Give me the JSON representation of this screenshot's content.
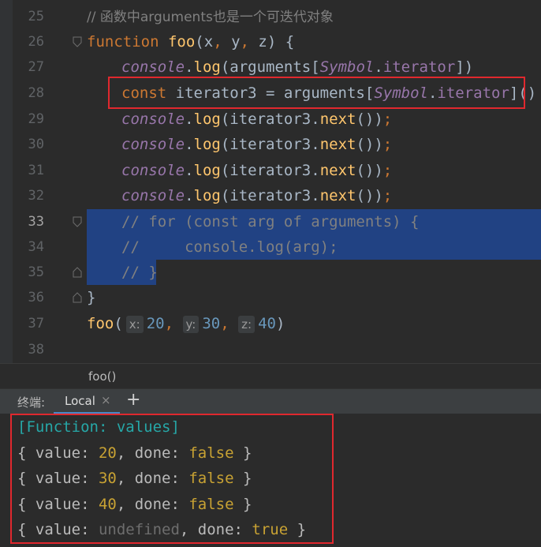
{
  "editor": {
    "line_numbers": [
      "25",
      "26",
      "27",
      "28",
      "29",
      "30",
      "31",
      "32",
      "33",
      "34",
      "35",
      "36",
      "37",
      "38"
    ],
    "active_line": "33",
    "lines": {
      "l25": {
        "comment": "// 函数中arguments也是一个可迭代对象"
      },
      "l26": {
        "kw": "function",
        "name": " foo",
        "open": "(",
        "p1": "x",
        "c1": ", ",
        "p2": "y",
        "c2": ", ",
        "p3": "z",
        "close": ") {"
      },
      "l27": {
        "obj": "console",
        "dot": ".",
        "method": "log",
        "a": "(arguments[",
        "sym": "Symbol",
        "b": ".",
        "prop": "iterator",
        "c": "])"
      },
      "l28": {
        "kw": "const",
        "a": " iterator3 = arguments[",
        "sym": "Symbol",
        "b": ".",
        "prop": "iterator",
        "c": "]()"
      },
      "l29": {
        "obj": "console",
        "dot": ".",
        "method": "log",
        "a": "(iterator3.",
        "m2": "next",
        "b": "())",
        "semi": ";"
      },
      "l30": {
        "obj": "console",
        "dot": ".",
        "method": "log",
        "a": "(iterator3.",
        "m2": "next",
        "b": "())",
        "semi": ";"
      },
      "l31": {
        "obj": "console",
        "dot": ".",
        "method": "log",
        "a": "(iterator3.",
        "m2": "next",
        "b": "())",
        "semi": ";"
      },
      "l32": {
        "obj": "console",
        "dot": ".",
        "method": "log",
        "a": "(iterator3.",
        "m2": "next",
        "b": "())",
        "semi": ";"
      },
      "l33": {
        "comment": "// for (const arg of arguments) {"
      },
      "l34": {
        "comment": "//     console.log(arg);"
      },
      "l35": {
        "comment": "// }"
      },
      "l36": {
        "text": "}"
      },
      "l37": {
        "fn": "foo",
        "open": "(",
        "h1": "x:",
        "v1": "20",
        "c1": ", ",
        "h2": "y:",
        "v2": "30",
        "c2": ", ",
        "h3": "z:",
        "v3": "40",
        "close": ")"
      }
    }
  },
  "breadcrumb": {
    "label": "foo()"
  },
  "terminal": {
    "label": "终端:",
    "tab_label": "Local",
    "close_glyph": "×",
    "add_glyph": "+",
    "output": {
      "o1": "[Function: values]",
      "o2": {
        "a": "{ value: ",
        "v": "20",
        "b": ", done: ",
        "d": "false",
        "c": " }"
      },
      "o3": {
        "a": "{ value: ",
        "v": "30",
        "b": ", done: ",
        "d": "false",
        "c": " }"
      },
      "o4": {
        "a": "{ value: ",
        "v": "40",
        "b": ", done: ",
        "d": "false",
        "c": " }"
      },
      "o5": {
        "a": "{ value: ",
        "v": "undefined",
        "b": ", done: ",
        "d": "true",
        "c": " }"
      }
    }
  },
  "colors": {
    "background": "#2b2b2b",
    "selection": "#214283",
    "highlight_box": "#e0282e",
    "keyword": "#cc7832",
    "function": "#ffc66d"
  }
}
